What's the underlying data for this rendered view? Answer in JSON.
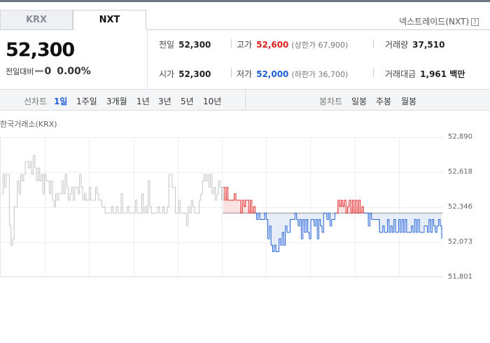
{
  "tabs": [
    {
      "label": "KRX"
    },
    {
      "label": "NXT"
    }
  ],
  "source_label": "넥스트레이드(NXT)",
  "help_glyph": "?",
  "price": "52,300",
  "diff_label": "전일대비",
  "diff_value": "0",
  "diff_pct": "0.00%",
  "stats": {
    "prev": {
      "label": "전일",
      "value": "52,300"
    },
    "high": {
      "label": "고가",
      "value": "52,600",
      "sub": "(상한가 67,900)"
    },
    "volume": {
      "label": "거래량",
      "value": "37,510"
    },
    "open": {
      "label": "시가",
      "value": "52,300"
    },
    "low": {
      "label": "저가",
      "value": "52,000",
      "sub": "(하한가 36,700)"
    },
    "amount": {
      "label": "거래대금",
      "value": "1,961 백만"
    }
  },
  "period": {
    "line_label": "선차트",
    "line_items": [
      "1일",
      "1주일",
      "3개월",
      "1년",
      "3년",
      "5년",
      "10년"
    ],
    "line_active": "1일",
    "candle_label": "봉차트",
    "candle_items": [
      "일봉",
      "주봉",
      "월봉"
    ]
  },
  "market_label": "한국거래소(KRX)",
  "colors": {
    "up": "#e02020",
    "down": "#1f5fd6",
    "flat": "#c4c4c4",
    "up_fill": "#fbe2e2",
    "down_fill": "#e6edf8"
  },
  "chart_data": {
    "type": "line",
    "title": "",
    "y_ticks": [
      52890,
      52618,
      52346,
      52073,
      51801
    ],
    "y_tick_labels": [
      "52,890",
      "52,618",
      "52,346",
      "52,073",
      "51,801"
    ],
    "ylim": [
      51801,
      52890
    ],
    "baseline": 52300,
    "series": [
      {
        "values": [
          52450,
          52600,
          52500,
          52600,
          52600,
          52200,
          52050,
          52100,
          52350,
          52350,
          52550,
          52450,
          52600,
          52550,
          52600,
          52700,
          52700,
          52650,
          52700,
          52600,
          52750,
          52650,
          52550,
          52650,
          52550,
          52600,
          52450,
          52600,
          52550,
          52550,
          52450,
          52550,
          52400,
          52350,
          52450,
          52400,
          52450,
          52450,
          52550,
          52450,
          52600,
          52500,
          52400,
          52450,
          52500,
          52400,
          52500,
          52500,
          52450,
          52600,
          52500,
          52400,
          52450,
          52400,
          52400,
          52500,
          52400,
          52400,
          52400,
          52500,
          52450,
          52400,
          52400,
          52350,
          52350,
          52300,
          52300,
          52300,
          52300,
          52350,
          52300,
          52300,
          52350,
          52300,
          52300,
          52450,
          52300,
          52300,
          52300,
          52350,
          52300,
          52300,
          52300,
          52300,
          52400,
          52300,
          52300,
          52300,
          52450,
          52300,
          52350,
          52300,
          52550,
          52350,
          52300,
          52300,
          52300,
          52300,
          52350,
          52300,
          52300,
          52350,
          52300,
          52300,
          52350,
          52600,
          52600,
          52500,
          52500,
          52300,
          52300,
          52400,
          52300,
          52300,
          52300,
          52300,
          52200,
          52350,
          52300,
          52400,
          52350,
          52300,
          52300,
          52300,
          52400,
          52450,
          52550,
          52600,
          52550,
          52600,
          52500,
          52600,
          52450,
          52500,
          52400,
          52450,
          52550,
          52500,
          52400,
          52500,
          52400,
          52500,
          52400,
          52400,
          52400,
          52400,
          52450,
          52400,
          52400,
          52400,
          52300,
          52400,
          52350,
          52400,
          52400,
          52300,
          52400,
          52300,
          52350,
          52300,
          52250,
          52300,
          52250,
          52250,
          52250,
          52300,
          52250,
          52100,
          52200,
          52050,
          52000,
          52050,
          52000,
          52000,
          52100,
          52050,
          52150,
          52050,
          52200,
          52150,
          52150,
          52250,
          52250,
          52250,
          52300,
          52250,
          52200,
          52250,
          52100,
          52250,
          52150,
          52250,
          52150,
          52100,
          52250,
          52250,
          52200,
          52250,
          52100,
          52250,
          52200,
          52150,
          52300,
          52300,
          52250,
          52300,
          52200,
          52250,
          52250,
          52300,
          52300,
          52400,
          52350,
          52400,
          52350,
          52400,
          52300,
          52350,
          52400,
          52300,
          52400,
          52300,
          52400,
          52300,
          52400,
          52300,
          52350,
          52300,
          52300,
          52300,
          52200,
          52300,
          52250,
          52250,
          52250,
          52250,
          52250,
          52150,
          52150,
          52200,
          52150,
          52150,
          52250,
          52150,
          52200,
          52150,
          52250,
          52150,
          52150,
          52250,
          52150,
          52250,
          52150,
          52250,
          52150,
          52150,
          52150,
          52200,
          52150,
          52250,
          52150,
          52250,
          52150,
          52150,
          52150,
          52200,
          52200,
          52150,
          52250,
          52150,
          52250,
          52200,
          52150,
          52200,
          52250,
          52200,
          52100
        ]
      }
    ]
  }
}
